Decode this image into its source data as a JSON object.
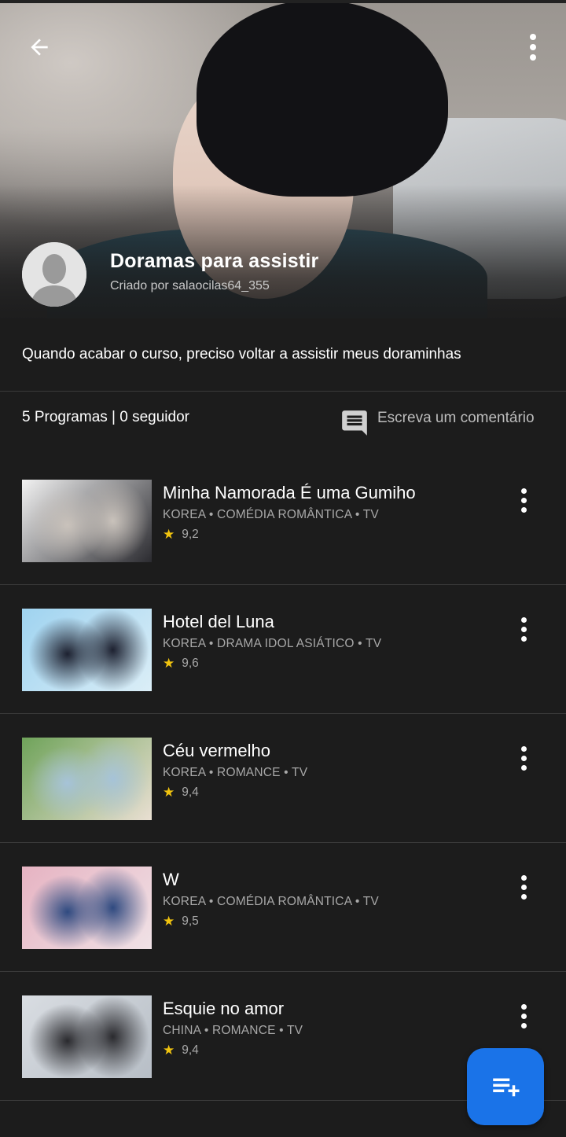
{
  "header": {
    "title": "Doramas para assistir",
    "creator": "Criado por salaocilas64_355"
  },
  "description": "Quando acabar o curso, preciso voltar a assistir meus doraminhas",
  "stats": "5 Programas | 0 seguidor",
  "comment_label": "Escreva um comentário",
  "items": [
    {
      "title": "Minha Namorada É uma Gumiho",
      "meta": "KOREA  •  COMÉDIA ROMÂNTICA  •  TV",
      "rating": "9,2",
      "colors": [
        "#f2f2f2",
        "#c9c2bb",
        "#2b2b30"
      ]
    },
    {
      "title": "Hotel del Luna",
      "meta": "KOREA  •  DRAMA IDOL ASIÁTICO  •  TV",
      "rating": "9,6",
      "colors": [
        "#9fd3f0",
        "#1d2130",
        "#dbeef7"
      ]
    },
    {
      "title": "Céu vermelho",
      "meta": "KOREA  •  ROMANCE  •  TV",
      "rating": "9,4",
      "colors": [
        "#6fa35a",
        "#a6c3d8",
        "#e9dfd2"
      ]
    },
    {
      "title": "W",
      "meta": "KOREA  •  COMÉDIA ROMÂNTICA  •  TV",
      "rating": "9,5",
      "colors": [
        "#e6b3c2",
        "#2f4a80",
        "#f0e2e6"
      ]
    },
    {
      "title": "Esquie no amor",
      "meta": "CHINA  •  ROMANCE  •  TV",
      "rating": "9,4",
      "colors": [
        "#d9dde2",
        "#2a2a2e",
        "#b7bec6"
      ]
    }
  ],
  "icons": {
    "back": "arrow-left-icon",
    "menu": "more-vert-icon",
    "comment": "comment-icon",
    "fab": "playlist-add-icon",
    "rating": "star-icon"
  },
  "colors": {
    "accent": "#1a73e8",
    "background": "#1c1c1c",
    "star": "#f1c40f"
  }
}
